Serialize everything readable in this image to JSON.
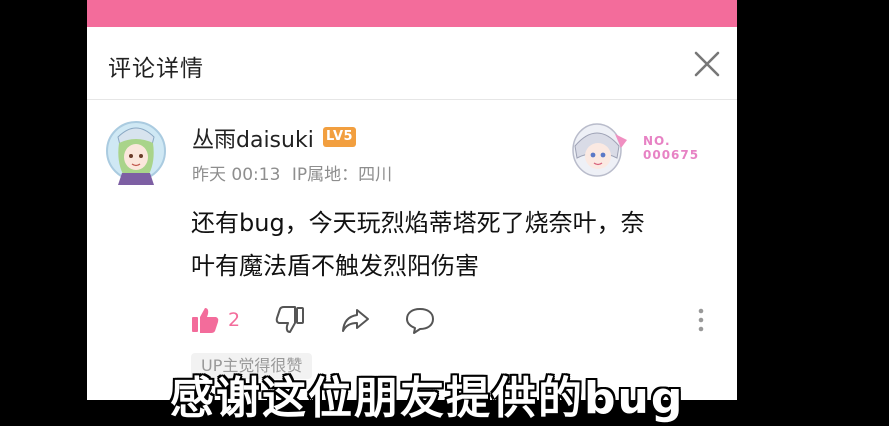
{
  "header": {
    "title": "评论详情",
    "close_icon": "close-icon"
  },
  "comment": {
    "username": "丛雨daisuki",
    "level": "LV5",
    "time": "昨天 00:13",
    "ip_location": "IP属地：四川",
    "badge_text_1": "NO.",
    "badge_text_2": "000675",
    "content_line1": "还有bug，今天玩烈焰蒂塔死了烧奈叶，奈",
    "content_line2": "叶有魔法盾不触发烈阳伤害",
    "likes": "2"
  },
  "footer_tag": "UP主觉得很赞",
  "subtitle": "感谢这位朋友提供的bug",
  "colors": {
    "accent": "#f36c9b",
    "level": "#f29f3f"
  }
}
